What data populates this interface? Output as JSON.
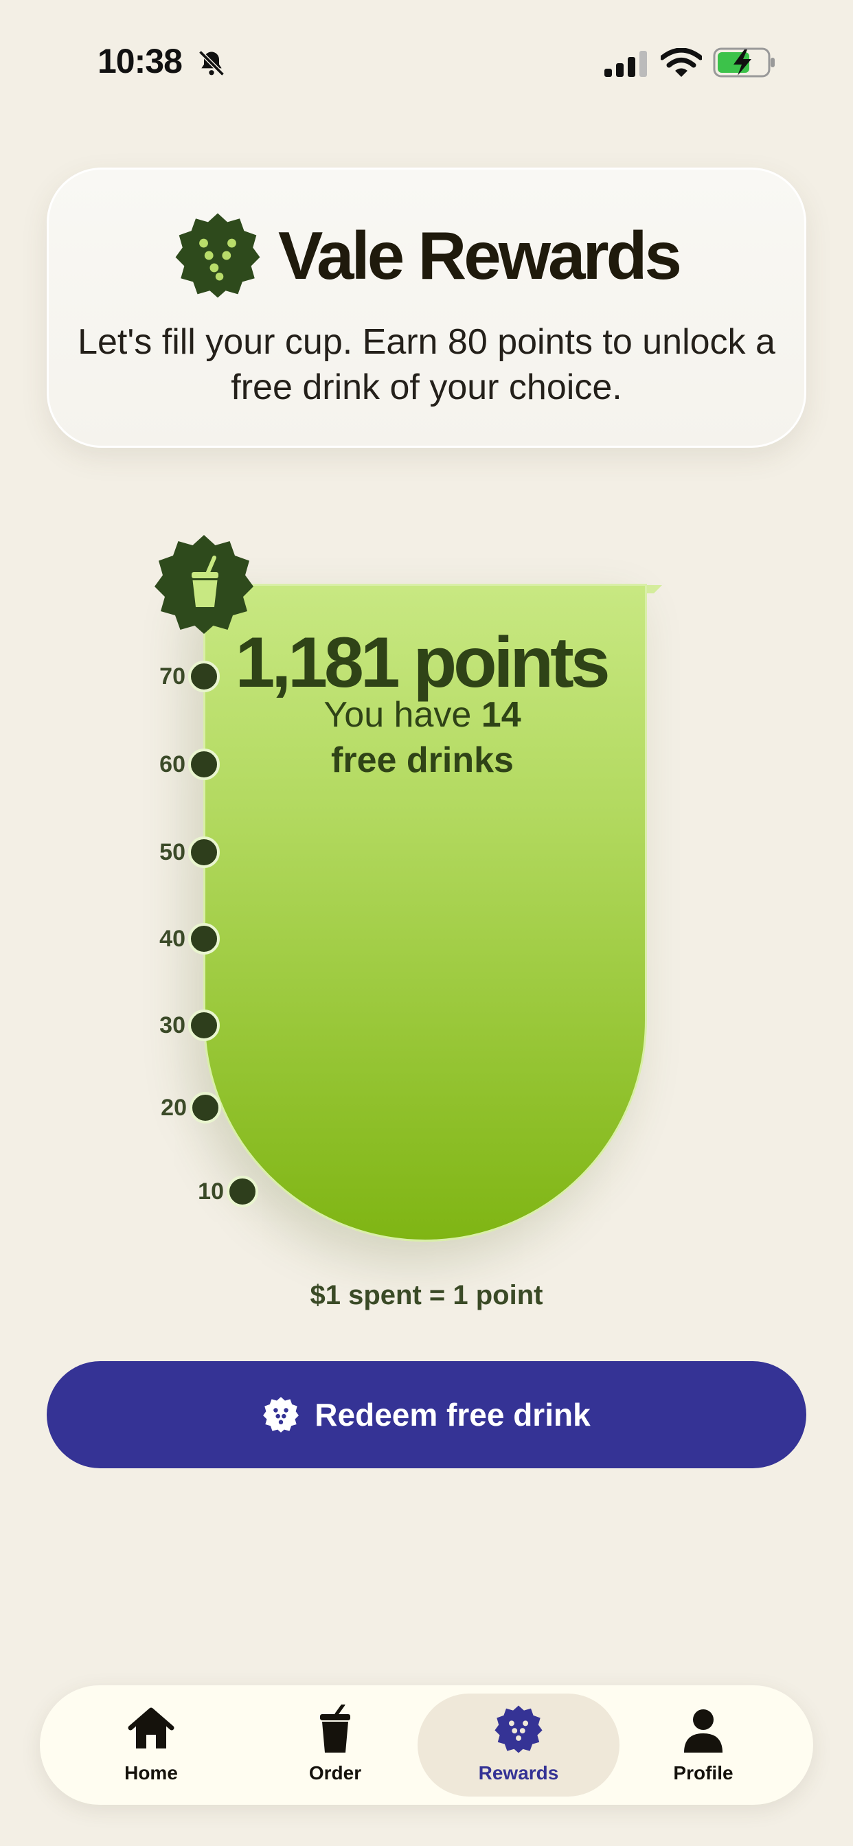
{
  "status_bar": {
    "time": "10:38"
  },
  "header": {
    "title": "Vale Rewards",
    "tagline": "Let's fill your cup. Earn 80 points to unlock a free drink of your choice."
  },
  "cup": {
    "points_label": "1,181 points",
    "free_prefix": "You have",
    "free_count": "14",
    "free_suffix": "free drinks",
    "progress_goal": 80,
    "ticks": [
      "70",
      "60",
      "50",
      "40",
      "30",
      "20",
      "10"
    ]
  },
  "earn_rule": "$1 spent = 1 point",
  "redeem_button": {
    "label": "Redeem free drink"
  },
  "nav": {
    "items": [
      {
        "label": "Home",
        "icon": "home-icon"
      },
      {
        "label": "Order",
        "icon": "cup-icon"
      },
      {
        "label": "Rewards",
        "icon": "rewards-badge-icon",
        "active": true
      },
      {
        "label": "Profile",
        "icon": "person-icon"
      }
    ]
  },
  "colors": {
    "accent": "#353395",
    "brand_green": "#2e4a1c",
    "cup_green": "#97c636",
    "background": "#f3efe5"
  }
}
